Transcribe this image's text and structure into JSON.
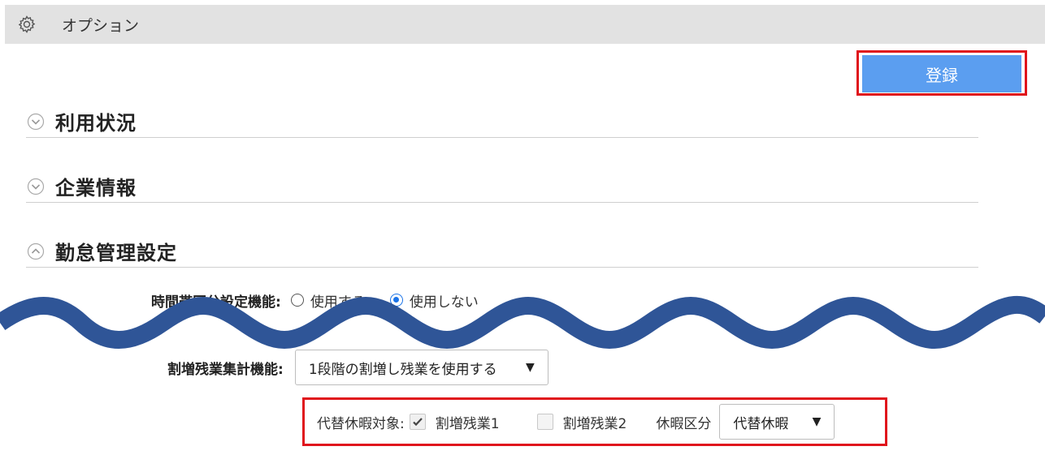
{
  "header": {
    "title": "オプション",
    "icon": "gear-icon"
  },
  "toolbar": {
    "register_label": "登録"
  },
  "sections": [
    {
      "title": "利用状況",
      "expanded": false
    },
    {
      "title": "企業情報",
      "expanded": false
    },
    {
      "title": "勤怠管理設定",
      "expanded": true
    }
  ],
  "time_zone_setting": {
    "label": "時間帯区分設定機能:",
    "options": [
      "使用する",
      "使用しない"
    ],
    "selected": "使用しない"
  },
  "overtime_setting": {
    "label": "割増残業集計機能:",
    "selected": "1段階の割増し残業を使用する"
  },
  "substitute_leave": {
    "label": "代替休暇対象:",
    "option1": {
      "label": "割増残業1",
      "checked": true
    },
    "option2": {
      "label": "割増残業2",
      "checked": false
    },
    "leave_type_label": "休暇区分",
    "leave_type_selected": "代替休暇"
  },
  "colors": {
    "accent": "#5b9ef0",
    "highlight": "#e0141c",
    "wave": "#2f5597"
  }
}
